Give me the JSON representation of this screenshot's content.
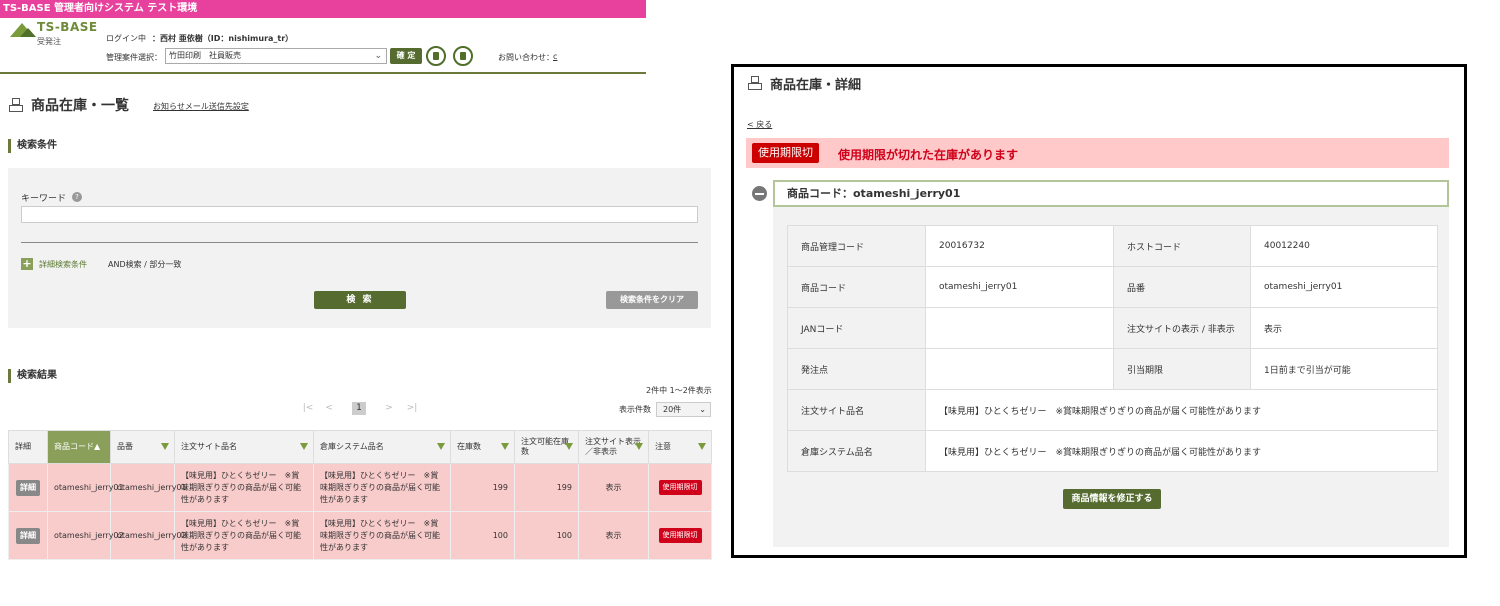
{
  "env_banner": "TS-BASE 管理者向けシステム テスト環境",
  "header": {
    "logo_brand": "TS-BASE",
    "logo_sub": "受発注",
    "login_label": "ログイン中",
    "login_user": "：西村 亜依樹（ID：nishimura_tr）",
    "case_label": "管理案件選択：",
    "case_value": "竹田印刷　社員販売",
    "confirm_label": "確 定",
    "contact_label": "お問い合わせ：",
    "contact_link": "c"
  },
  "list_page": {
    "title": "商品在庫・一覧",
    "notify_link": "お知らせメール送信先設定",
    "search_section": "検索条件",
    "keyword_label": "キーワード",
    "keyword_value": "",
    "advanced_label": "詳細検索条件",
    "advanced_mode": "AND検索 / 部分一致",
    "search_btn": "検 索",
    "clear_btn": "検索条件をクリア",
    "results_section": "検索結果",
    "result_count": "2件中 1〜2件表示",
    "pagination": {
      "first": "|<",
      "prev": "<",
      "current": "1",
      "next": ">",
      "last": ">|"
    },
    "per_page_label": "表示件数",
    "per_page_value": "20件",
    "columns": [
      "詳細",
      "商品コード▲",
      "品番",
      "注文サイト品名",
      "倉庫システム品名",
      "在庫数",
      "注文可能在庫数",
      "注文サイト表示／非表示",
      "注意"
    ],
    "rows": [
      {
        "detail": "詳細",
        "code": "otameshi_jerry01",
        "part": "otameshi_jerry01",
        "site_name": "【味見用】ひとくちゼリー　※賞味期限ぎりぎりの商品が届く可能性があります",
        "wh_name": "【味見用】ひとくちゼリー　※賞味期限ぎりぎりの商品が届く可能性があります",
        "stock": "199",
        "orderable": "199",
        "visibility": "表示",
        "note": "使用期限切"
      },
      {
        "detail": "詳細",
        "code": "otameshi_jerry02",
        "part": "otameshi_jerry02",
        "site_name": "【味見用】ひとくちゼリー　※賞味期限ぎりぎりの商品が届く可能性があります",
        "wh_name": "【味見用】ひとくちゼリー　※賞味期限ぎりぎりの商品が届く可能性があります",
        "stock": "100",
        "orderable": "100",
        "visibility": "表示",
        "note": "使用期限切"
      }
    ]
  },
  "detail_page": {
    "title": "商品在庫・詳細",
    "back_link": "< 戻る",
    "expired_tag": "使用期限切",
    "expired_msg": "使用期限が切れた在庫があります",
    "code_header": "商品コード：otameshi_jerry01",
    "fields": {
      "mgmt_code_label": "商品管理コード",
      "mgmt_code": "20016732",
      "host_code_label": "ホストコード",
      "host_code": "40012240",
      "product_code_label": "商品コード",
      "product_code": "otameshi_jerry01",
      "part_no_label": "品番",
      "part_no": "otameshi_jerry01",
      "jan_label": "JANコード",
      "jan": "",
      "visibility_label": "注文サイトの表示 / 非表示",
      "visibility": "表示",
      "reorder_label": "発注点",
      "reorder": "",
      "deadline_label": "引当期限",
      "deadline": "1日前まで引当が可能",
      "site_name_label": "注文サイト品名",
      "site_name": "【味見用】ひとくちゼリー　※賞味期限ぎりぎりの商品が届く可能性があります",
      "wh_name_label": "倉庫システム品名",
      "wh_name": "【味見用】ひとくちゼリー　※賞味期限ぎりぎりの商品が届く可能性があります"
    },
    "edit_btn": "商品情報を修正する"
  },
  "colors": {
    "brand_green": "#556b2f",
    "banner_pink": "#e8419d",
    "alert_red": "#d0021b",
    "alert_bg": "#ffc9c9"
  }
}
